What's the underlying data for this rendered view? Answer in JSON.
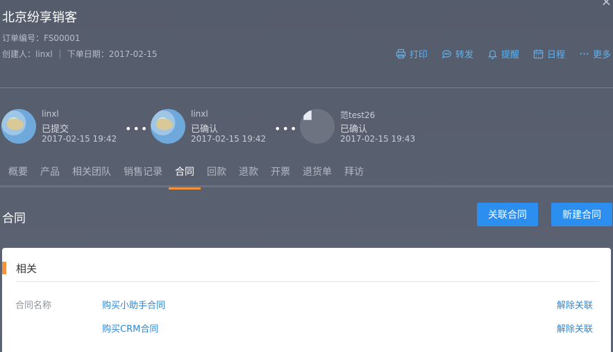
{
  "header": {
    "title": "北京纷享销客",
    "order_no": "订单编号：FS00001",
    "creator": "创建人：linxl",
    "order_date": "下单日期：2017-02-15",
    "close_label": "×"
  },
  "actions": [
    {
      "label": "打印",
      "icon": "print-icon"
    },
    {
      "label": "转发",
      "icon": "forward-icon"
    },
    {
      "label": "提醒",
      "icon": "bell-icon"
    },
    {
      "label": "日程",
      "icon": "calendar-icon"
    },
    {
      "label": "更多",
      "icon": "more-icon"
    }
  ],
  "flow": [
    {
      "user": "linxl",
      "status": "已提交",
      "time": "2017-02-15 19:42"
    },
    {
      "user": "linxl",
      "status": "已确认",
      "time": "2017-02-15 19:42"
    },
    {
      "user": "范test26",
      "status": "已确认",
      "time": "2017-02-15 19:43"
    }
  ],
  "tabs": [
    "概要",
    "产品",
    "相关团队",
    "销售记录",
    "合同",
    "回款",
    "退款",
    "开票",
    "退货单",
    "拜访"
  ],
  "active_tab": "合同",
  "section": {
    "title": "合同",
    "link_button": "关联合同",
    "new_button": "新建合同"
  },
  "card": {
    "heading": "相关",
    "field_label": "合同名称",
    "rows": [
      {
        "name": "购买小助手合同",
        "action": "解除关联"
      },
      {
        "name": "购买CRM合同",
        "action": "解除关联"
      }
    ]
  },
  "colors": {
    "accent": "#f7913a",
    "primary": "#2c8ff0",
    "link": "#5eb2f0"
  }
}
